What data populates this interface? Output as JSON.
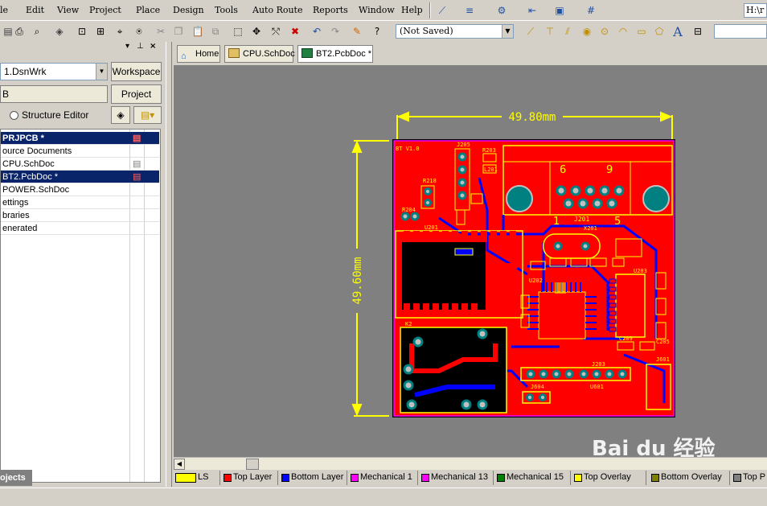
{
  "menu": [
    "le",
    "Edit",
    "View",
    "Project",
    "Place",
    "Design",
    "Tools",
    "Auto Route",
    "Reports",
    "Window",
    "Help"
  ],
  "path_box": "H:\\r",
  "toolbar2": {
    "combo_value": "(Not Saved)"
  },
  "panel": {
    "workspace_combo": "1.DsnWrk",
    "workspace_button": "Workspace",
    "project_field": "B",
    "project_button": "Project",
    "structure_editor": "Structure Editor",
    "tree": [
      {
        "label": "PRJPCB *",
        "selected": true,
        "bold": true
      },
      {
        "label": "ource Documents",
        "selected": false
      },
      {
        "label": "CPU.SchDoc",
        "selected": false
      },
      {
        "label": "BT2.PcbDoc *",
        "selected": true
      },
      {
        "label": "POWER.SchDoc",
        "selected": false
      },
      {
        "label": "ettings",
        "selected": false
      },
      {
        "label": "braries",
        "selected": false
      },
      {
        "label": "enerated",
        "selected": false
      }
    ],
    "bottom_tab": "ojects"
  },
  "tabs": [
    {
      "label": "Home"
    },
    {
      "label": "CPU.SchDoc"
    },
    {
      "label": "BT2.PcbDoc *"
    }
  ],
  "pcb": {
    "width_dim": "49.80mm",
    "height_dim": "49.60mm",
    "silk": {
      "board_id": "BT V1.0",
      "j205": "J205",
      "r203": "R203",
      "l201": "L201",
      "r218": "R218",
      "r204": "R204",
      "u201": "U201",
      "n6": "6",
      "n9": "9",
      "n1": "1",
      "n5": "5",
      "j201": "J201",
      "x201": "X201",
      "k2": "K2",
      "j203": "J203",
      "j601": "J601",
      "j604": "J604",
      "u601": "U601",
      "c209": "C209",
      "c205": "C205",
      "u202": "U202",
      "u203": "U203"
    }
  },
  "layers": [
    {
      "label": "LS",
      "color": "#ffff00"
    },
    {
      "label": "Top Layer",
      "color": "#ff0000"
    },
    {
      "label": "Bottom Layer",
      "color": "#0000ff"
    },
    {
      "label": "Mechanical 1",
      "color": "#ff00ff"
    },
    {
      "label": "Mechanical 13",
      "color": "#ff00ff"
    },
    {
      "label": "Mechanical 15",
      "color": "#008000"
    },
    {
      "label": "Top Overlay",
      "color": "#ffff00"
    },
    {
      "label": "Bottom Overlay",
      "color": "#808000"
    },
    {
      "label": "Top P",
      "color": "#808080"
    }
  ],
  "watermark": "Bai du 经验",
  "colors": {
    "board": "#ff0000",
    "bottom": "#0000ff",
    "overlay": "#ffff00",
    "copper_pad": "#c0c0c0",
    "select": "#0a246a"
  }
}
